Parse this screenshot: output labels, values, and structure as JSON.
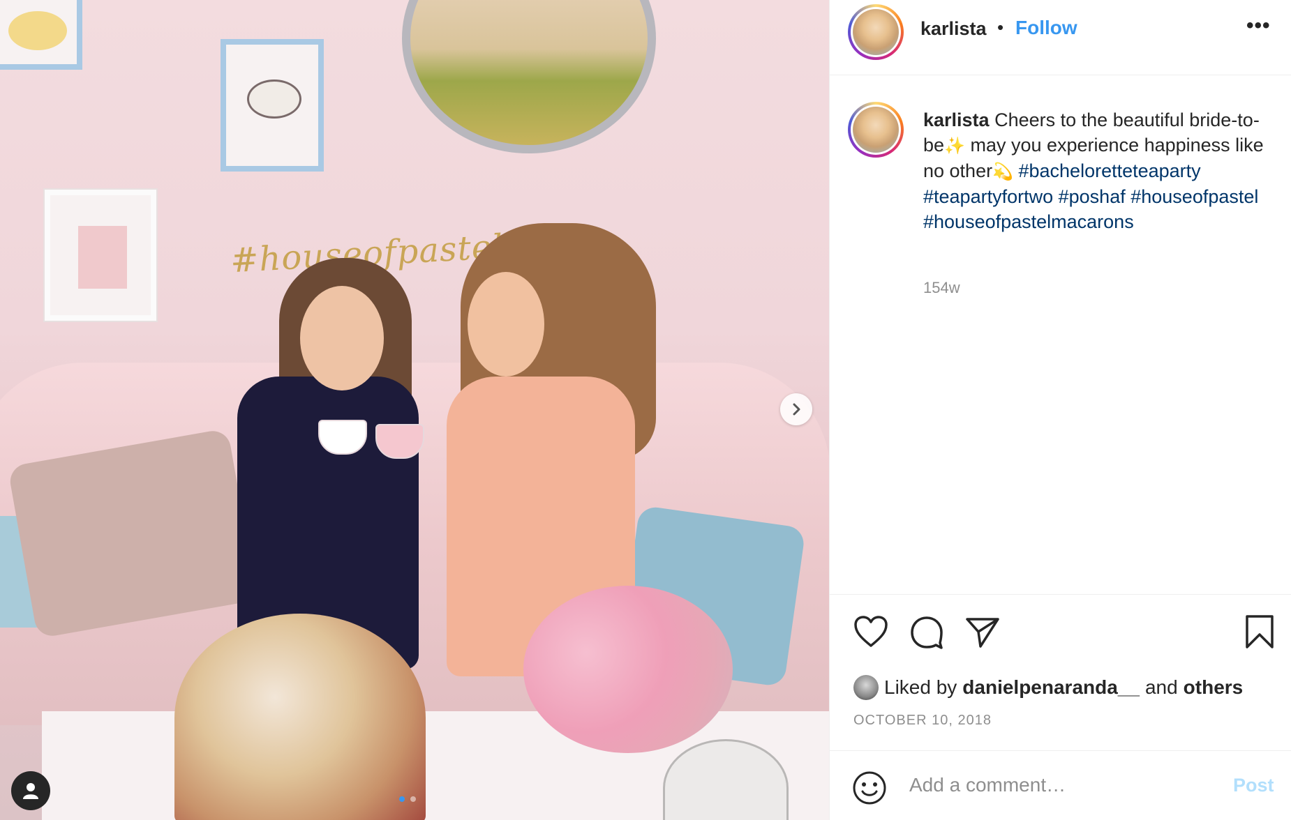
{
  "post": {
    "username": "karlista",
    "follow_label": "Follow",
    "separator": "•",
    "more_label": "•••"
  },
  "caption": {
    "username": "karlista",
    "text_1": "Cheers to the beautiful bride-to-be",
    "emoji_1": "✨",
    "text_2": "may you experience happiness like no other",
    "emoji_2": "💫",
    "hashtags": [
      "#bachelorette​teaparty",
      "#teapartyfortwo",
      "#poshaf",
      "#houseofpastel",
      "#houseofpastelmacarons"
    ],
    "age": "154w"
  },
  "photo": {
    "wall_text": "#houseofpastel",
    "carousel_total": 2,
    "carousel_active": 1,
    "next_icon": "chevron-right-icon",
    "tag_icon": "user-icon"
  },
  "actions": {
    "like_icon": "heart-icon",
    "comment_icon": "comment-icon",
    "share_icon": "paper-plane-icon",
    "save_icon": "bookmark-icon"
  },
  "likes": {
    "prefix": "Liked by",
    "user": "danielpenaranda__",
    "connector": "and",
    "others": "others"
  },
  "date": "OCTOBER 10, 2018",
  "comment": {
    "placeholder": "Add a comment…",
    "post_label": "Post"
  },
  "colors": {
    "link_blue": "#3897f0",
    "hashtag": "#003569",
    "post_disabled": "#b2dffc",
    "muted": "#8e8e8e"
  }
}
